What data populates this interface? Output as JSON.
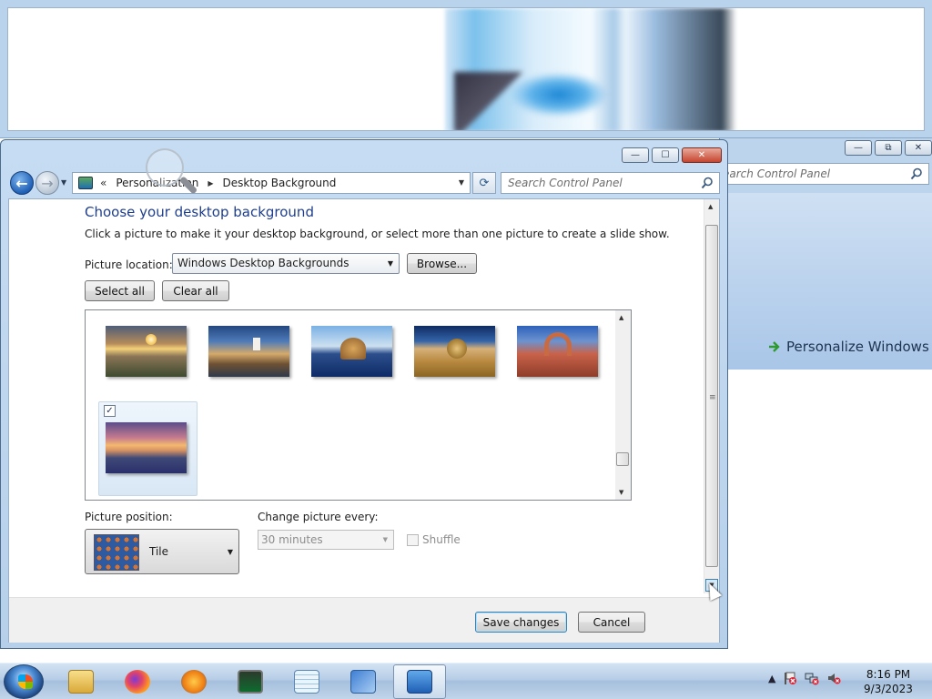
{
  "main_window": {
    "controls": {
      "minimize": "—",
      "maximize": "☐",
      "close": "✕"
    },
    "breadcrumb": [
      "Personalization",
      "Desktop Background"
    ],
    "search_placeholder": "Search Control Panel",
    "title": "Choose your desktop background",
    "description": "Click a picture to make it your desktop background, or select more than one picture to create a slide show.",
    "picture_location_label": "Picture location:",
    "picture_location_value": "Windows Desktop Backgrounds",
    "browse_label": "Browse...",
    "select_all_label": "Select all",
    "clear_all_label": "Clear all",
    "gallery": {
      "thumbnails": [
        "sunset-field",
        "lighthouse",
        "rock-lake",
        "hay-bale",
        "red-arch",
        "lavender-sunset"
      ],
      "selected": {
        "index": 5,
        "checked": true
      }
    },
    "picture_position_label": "Picture position:",
    "picture_position_value": "Tile",
    "change_picture_label": "Change picture every:",
    "change_picture_value": "30 minutes",
    "shuffle_label": "Shuffle",
    "shuffle_checked": false,
    "save_label": "Save changes",
    "cancel_label": "Cancel"
  },
  "background_window": {
    "search_placeholder": "earch Control Panel",
    "link_label": "Personalize Windows"
  },
  "taskbar": {
    "apps": [
      "windows-explorer",
      "firefox",
      "media-player",
      "task-manager",
      "notepad",
      "network-search",
      "control-panel"
    ],
    "active_app": "control-panel",
    "time": "8:16 PM",
    "date": "9/3/2023"
  },
  "colors": {
    "title_blue": "#1e3e8c",
    "window_frame": "#b9d3ec",
    "close_red": "#c6452e"
  }
}
